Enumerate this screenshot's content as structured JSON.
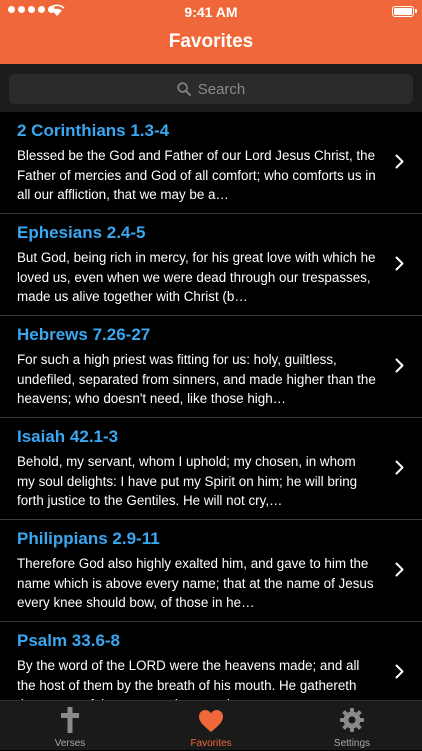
{
  "status_bar": {
    "time": "9:41 AM"
  },
  "nav": {
    "title": "Favorites"
  },
  "search": {
    "placeholder": "Search"
  },
  "verses": [
    {
      "reference": "2 Corinthians 1.3-4",
      "text": "Blessed be the God and Father of our Lord Jesus Christ, the Father of mercies and God of all comfort; who comforts us in all our affliction, that we may be a…"
    },
    {
      "reference": "Ephesians 2.4-5",
      "text": "But God, being rich in mercy, for his great love with which he loved us, even when we were dead through our trespasses, made us alive together with Christ (b…"
    },
    {
      "reference": "Hebrews 7.26-27",
      "text": "For such a high priest was fitting for us: holy, guiltless, undefiled, separated from sinners, and made higher than the heavens; who doesn't need, like those high…"
    },
    {
      "reference": "Isaiah 42.1-3",
      "text": "Behold, my servant, whom I uphold; my chosen, in whom my soul delights: I have put my Spirit on him; he will bring forth justice to the Gentiles. He will not cry,…"
    },
    {
      "reference": "Philippians 2.9-11",
      "text": "Therefore God also highly exalted him, and gave to him the name which is above every name; that at the name of Jesus every knee should bow, of those in he…"
    },
    {
      "reference": "Psalm 33.6-8",
      "text": "By the word of the LORD were the heavens made; and all the host of them by the breath of his mouth. He gathereth the waters of the sea together as a heap…"
    }
  ],
  "tabs": [
    {
      "label": "Verses",
      "icon": "cross-icon"
    },
    {
      "label": "Favorites",
      "icon": "heart-icon"
    },
    {
      "label": "Settings",
      "icon": "gear-icon"
    }
  ],
  "colors": {
    "accent": "#f0683a",
    "link": "#3aa7f0",
    "background": "#000000"
  }
}
